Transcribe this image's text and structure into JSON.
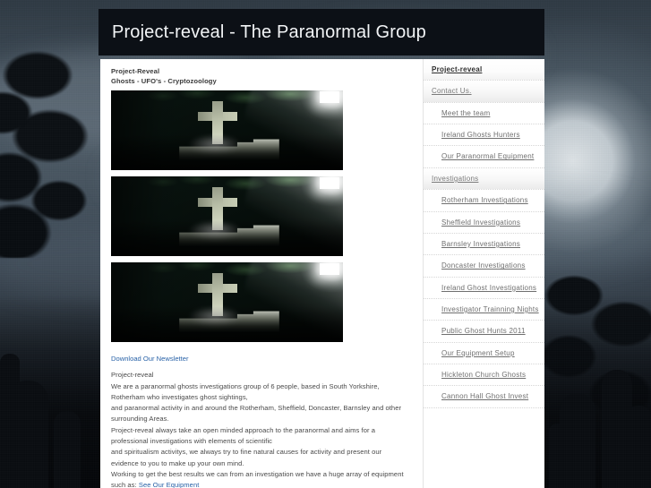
{
  "header": {
    "title": "Project-reveal - The Paranormal Group"
  },
  "content": {
    "heading_line1": "Project-Reveal",
    "heading_line2": "Ghosts - UFO's - Cryptozoology",
    "newsletter_link": "Download Our Newsletter",
    "body_lines": [
      "Project-reveal",
      "We are a paranormal ghosts investigations group of 6 people, based in South Yorkshire,",
      "Rotherham who investigates ghost sightings,",
      "and paranormal activity in and around the Rotherham, Sheffield, Doncaster, Barnsley and other",
      "surrounding Areas.",
      "Project-reveal always take an open minded approach to the paranormal and aims for a",
      "professional investigations with elements of scientific",
      "and spiritualism activitys, we always try to fine natural causes for activity and present our",
      "evidence to you to make up your own mind.",
      "Working to get the best results we can from an investigation we have a huge array of equipment"
    ],
    "last_line_prefix": "such as: ",
    "equipment_link": "See Our Equipment",
    "images": [
      {
        "alt": "Stone cross lit by a beam of light at night"
      },
      {
        "alt": "Stone cross lit by a beam of light at night"
      },
      {
        "alt": "Stone cross lit by a beam of light at night"
      }
    ]
  },
  "sidebar": {
    "items": [
      {
        "label": "Project-reveal",
        "level": 1,
        "active": true,
        "section": false
      },
      {
        "label": "Contact Us.",
        "level": 1,
        "active": false,
        "section": true
      },
      {
        "label": "Meet the team",
        "level": 2,
        "active": false,
        "section": false
      },
      {
        "label": "Ireland Ghosts Hunters",
        "level": 2,
        "active": false,
        "section": false
      },
      {
        "label": "Our Paranormal Equipment",
        "level": 2,
        "active": false,
        "section": false
      },
      {
        "label": "Investigations",
        "level": 1,
        "active": false,
        "section": true
      },
      {
        "label": "Rotherham Investigations",
        "level": 2,
        "active": false,
        "section": false
      },
      {
        "label": "Sheffield Investigations",
        "level": 2,
        "active": false,
        "section": false
      },
      {
        "label": "Barnsley Investigations",
        "level": 2,
        "active": false,
        "section": false
      },
      {
        "label": "Doncaster Investigations",
        "level": 2,
        "active": false,
        "section": false
      },
      {
        "label": "Ireland Ghost Investigations",
        "level": 2,
        "active": false,
        "section": false
      },
      {
        "label": "Investigator Trainning Nights",
        "level": 2,
        "active": false,
        "section": false
      },
      {
        "label": "Public Ghost Hunts 2011",
        "level": 2,
        "active": false,
        "section": false
      },
      {
        "label": "Our Equipment Setup",
        "level": 2,
        "active": false,
        "section": false
      },
      {
        "label": "Hickleton Church Ghosts",
        "level": 2,
        "active": false,
        "section": false
      },
      {
        "label": "Cannon Hall Ghost Invest",
        "level": 2,
        "active": false,
        "section": false
      }
    ]
  },
  "colors": {
    "header_bg": "#0c1016",
    "panel_bg": "#ffffff",
    "link": "#2a63a8",
    "body_text": "#4a4a4a",
    "nav_text": "#6f6f6f"
  }
}
